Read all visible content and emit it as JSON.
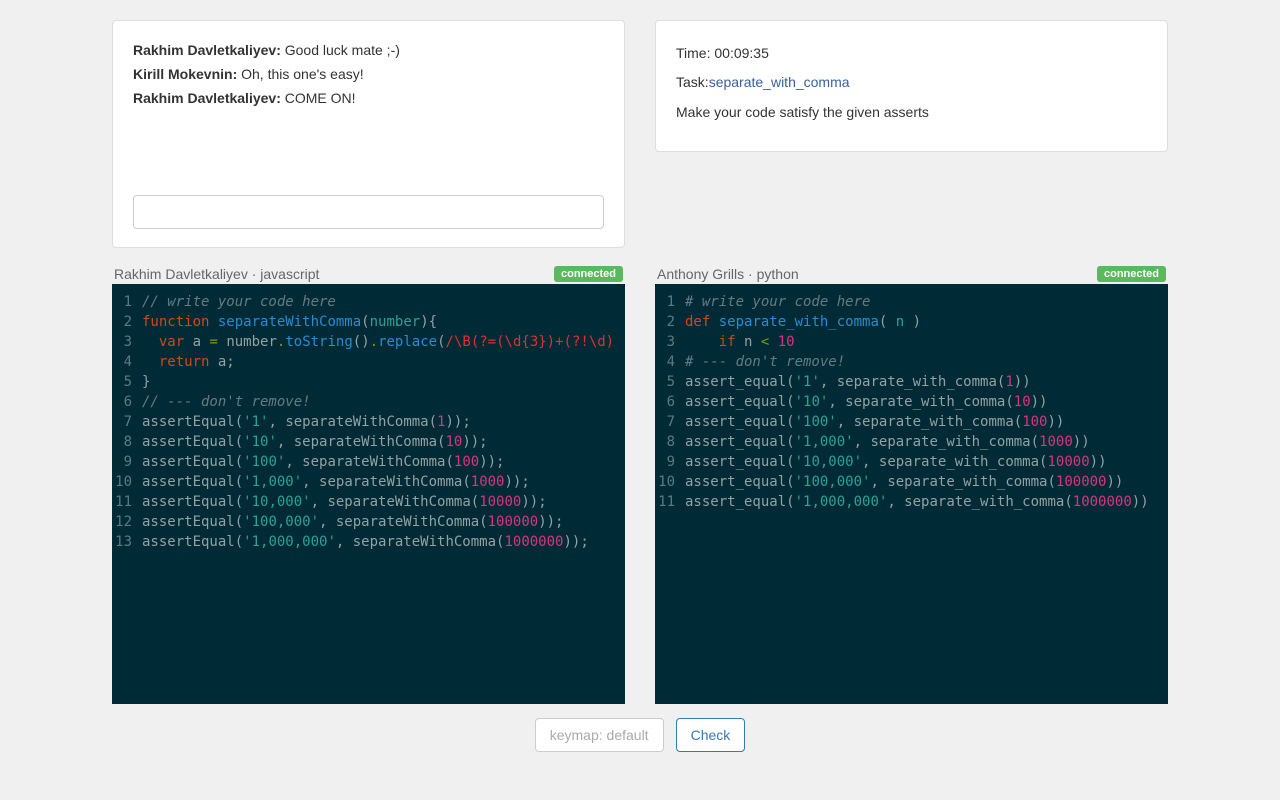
{
  "chat": {
    "messages": [
      {
        "author": "Rakhim Davletkaliyev",
        "text": "Good luck mate ;-)"
      },
      {
        "author": "Kirill Mokevnin",
        "text": "Oh, this one's easy!"
      },
      {
        "author": "Rakhim Davletkaliyev",
        "text": "COME ON!"
      }
    ],
    "input_value": ""
  },
  "info": {
    "time_label": "Time: ",
    "time_value": "00:09:35",
    "task_label": "Task:",
    "task_name": "separate_with_comma",
    "instructions": "Make your code satisfy the given asserts"
  },
  "editors": {
    "left": {
      "user": "Rakhim Davletkaliyev",
      "language": "javascript",
      "status": "connected",
      "lines": [
        [
          {
            "t": "comment",
            "v": "// write your code here"
          }
        ],
        [
          {
            "t": "keyword",
            "v": "function"
          },
          {
            "t": "plain",
            "v": " "
          },
          {
            "t": "func",
            "v": "separateWithComma"
          },
          {
            "t": "paren",
            "v": "("
          },
          {
            "t": "ident",
            "v": "number"
          },
          {
            "t": "paren",
            "v": "){"
          }
        ],
        [
          {
            "t": "plain",
            "v": "  "
          },
          {
            "t": "keyword",
            "v": "var"
          },
          {
            "t": "plain",
            "v": " a "
          },
          {
            "t": "op",
            "v": "="
          },
          {
            "t": "plain",
            "v": " number"
          },
          {
            "t": "op",
            "v": "."
          },
          {
            "t": "func",
            "v": "toString"
          },
          {
            "t": "paren",
            "v": "()"
          },
          {
            "t": "op",
            "v": "."
          },
          {
            "t": "func",
            "v": "replace"
          },
          {
            "t": "paren",
            "v": "("
          },
          {
            "t": "regex",
            "v": "/\\B(?=(\\d{3})+(?!\\d)"
          }
        ],
        [
          {
            "t": "plain",
            "v": "  "
          },
          {
            "t": "keyword",
            "v": "return"
          },
          {
            "t": "plain",
            "v": " a;"
          }
        ],
        [
          {
            "t": "paren",
            "v": "}"
          }
        ],
        [
          {
            "t": "comment",
            "v": "// --- don't remove!"
          }
        ],
        [
          {
            "t": "call",
            "v": "assertEqual"
          },
          {
            "t": "paren",
            "v": "("
          },
          {
            "t": "str",
            "v": "'1'"
          },
          {
            "t": "plain",
            "v": ", "
          },
          {
            "t": "call",
            "v": "separateWithComma"
          },
          {
            "t": "paren",
            "v": "("
          },
          {
            "t": "num",
            "v": "1"
          },
          {
            "t": "paren",
            "v": "));"
          }
        ],
        [
          {
            "t": "call",
            "v": "assertEqual"
          },
          {
            "t": "paren",
            "v": "("
          },
          {
            "t": "str",
            "v": "'10'"
          },
          {
            "t": "plain",
            "v": ", "
          },
          {
            "t": "call",
            "v": "separateWithComma"
          },
          {
            "t": "paren",
            "v": "("
          },
          {
            "t": "num",
            "v": "10"
          },
          {
            "t": "paren",
            "v": "));"
          }
        ],
        [
          {
            "t": "call",
            "v": "assertEqual"
          },
          {
            "t": "paren",
            "v": "("
          },
          {
            "t": "str",
            "v": "'100'"
          },
          {
            "t": "plain",
            "v": ", "
          },
          {
            "t": "call",
            "v": "separateWithComma"
          },
          {
            "t": "paren",
            "v": "("
          },
          {
            "t": "num",
            "v": "100"
          },
          {
            "t": "paren",
            "v": "));"
          }
        ],
        [
          {
            "t": "call",
            "v": "assertEqual"
          },
          {
            "t": "paren",
            "v": "("
          },
          {
            "t": "str",
            "v": "'1,000'"
          },
          {
            "t": "plain",
            "v": ", "
          },
          {
            "t": "call",
            "v": "separateWithComma"
          },
          {
            "t": "paren",
            "v": "("
          },
          {
            "t": "num",
            "v": "1000"
          },
          {
            "t": "paren",
            "v": "));"
          }
        ],
        [
          {
            "t": "call",
            "v": "assertEqual"
          },
          {
            "t": "paren",
            "v": "("
          },
          {
            "t": "str",
            "v": "'10,000'"
          },
          {
            "t": "plain",
            "v": ", "
          },
          {
            "t": "call",
            "v": "separateWithComma"
          },
          {
            "t": "paren",
            "v": "("
          },
          {
            "t": "num",
            "v": "10000"
          },
          {
            "t": "paren",
            "v": "));"
          }
        ],
        [
          {
            "t": "call",
            "v": "assertEqual"
          },
          {
            "t": "paren",
            "v": "("
          },
          {
            "t": "str",
            "v": "'100,000'"
          },
          {
            "t": "plain",
            "v": ", "
          },
          {
            "t": "call",
            "v": "separateWithComma"
          },
          {
            "t": "paren",
            "v": "("
          },
          {
            "t": "num",
            "v": "100000"
          },
          {
            "t": "paren",
            "v": "));"
          }
        ],
        [
          {
            "t": "call",
            "v": "assertEqual"
          },
          {
            "t": "paren",
            "v": "("
          },
          {
            "t": "str",
            "v": "'1,000,000'"
          },
          {
            "t": "plain",
            "v": ", "
          },
          {
            "t": "call",
            "v": "separateWithComma"
          },
          {
            "t": "paren",
            "v": "("
          },
          {
            "t": "num",
            "v": "1000000"
          },
          {
            "t": "paren",
            "v": "));"
          }
        ]
      ]
    },
    "right": {
      "user": "Anthony Grills",
      "language": "python",
      "status": "connected",
      "lines": [
        [
          {
            "t": "comment",
            "v": "# write your code here"
          }
        ],
        [
          {
            "t": "keyword",
            "v": "def"
          },
          {
            "t": "plain",
            "v": " "
          },
          {
            "t": "func",
            "v": "separate_with_comma"
          },
          {
            "t": "paren",
            "v": "( "
          },
          {
            "t": "ident",
            "v": "n"
          },
          {
            "t": "paren",
            "v": " )"
          }
        ],
        [
          {
            "t": "plain",
            "v": "    "
          },
          {
            "t": "keyword",
            "v": "if"
          },
          {
            "t": "plain",
            "v": " n "
          },
          {
            "t": "op",
            "v": "<"
          },
          {
            "t": "plain",
            "v": " "
          },
          {
            "t": "num",
            "v": "10"
          }
        ],
        [
          {
            "t": "comment",
            "v": "# --- don't remove!"
          }
        ],
        [
          {
            "t": "call",
            "v": "assert_equal"
          },
          {
            "t": "paren",
            "v": "("
          },
          {
            "t": "str",
            "v": "'1'"
          },
          {
            "t": "plain",
            "v": ", "
          },
          {
            "t": "call",
            "v": "separate_with_comma"
          },
          {
            "t": "paren",
            "v": "("
          },
          {
            "t": "num",
            "v": "1"
          },
          {
            "t": "paren",
            "v": "))"
          }
        ],
        [
          {
            "t": "call",
            "v": "assert_equal"
          },
          {
            "t": "paren",
            "v": "("
          },
          {
            "t": "str",
            "v": "'10'"
          },
          {
            "t": "plain",
            "v": ", "
          },
          {
            "t": "call",
            "v": "separate_with_comma"
          },
          {
            "t": "paren",
            "v": "("
          },
          {
            "t": "num",
            "v": "10"
          },
          {
            "t": "paren",
            "v": "))"
          }
        ],
        [
          {
            "t": "call",
            "v": "assert_equal"
          },
          {
            "t": "paren",
            "v": "("
          },
          {
            "t": "str",
            "v": "'100'"
          },
          {
            "t": "plain",
            "v": ", "
          },
          {
            "t": "call",
            "v": "separate_with_comma"
          },
          {
            "t": "paren",
            "v": "("
          },
          {
            "t": "num",
            "v": "100"
          },
          {
            "t": "paren",
            "v": "))"
          }
        ],
        [
          {
            "t": "call",
            "v": "assert_equal"
          },
          {
            "t": "paren",
            "v": "("
          },
          {
            "t": "str",
            "v": "'1,000'"
          },
          {
            "t": "plain",
            "v": ", "
          },
          {
            "t": "call",
            "v": "separate_with_comma"
          },
          {
            "t": "paren",
            "v": "("
          },
          {
            "t": "num",
            "v": "1000"
          },
          {
            "t": "paren",
            "v": "))"
          }
        ],
        [
          {
            "t": "call",
            "v": "assert_equal"
          },
          {
            "t": "paren",
            "v": "("
          },
          {
            "t": "str",
            "v": "'10,000'"
          },
          {
            "t": "plain",
            "v": ", "
          },
          {
            "t": "call",
            "v": "separate_with_comma"
          },
          {
            "t": "paren",
            "v": "("
          },
          {
            "t": "num",
            "v": "10000"
          },
          {
            "t": "paren",
            "v": "))"
          }
        ],
        [
          {
            "t": "call",
            "v": "assert_equal"
          },
          {
            "t": "paren",
            "v": "("
          },
          {
            "t": "str",
            "v": "'100,000'"
          },
          {
            "t": "plain",
            "v": ", "
          },
          {
            "t": "call",
            "v": "separate_with_comma"
          },
          {
            "t": "paren",
            "v": "("
          },
          {
            "t": "num",
            "v": "100000"
          },
          {
            "t": "paren",
            "v": "))"
          }
        ],
        [
          {
            "t": "call",
            "v": "assert_equal"
          },
          {
            "t": "paren",
            "v": "("
          },
          {
            "t": "str",
            "v": "'1,000,000'"
          },
          {
            "t": "plain",
            "v": ", "
          },
          {
            "t": "call",
            "v": "separate_with_comma"
          },
          {
            "t": "paren",
            "v": "("
          },
          {
            "t": "num",
            "v": "1000000"
          },
          {
            "t": "paren",
            "v": "))"
          }
        ]
      ]
    }
  },
  "footer": {
    "keymap_label": "keymap: default",
    "check_label": "Check"
  }
}
